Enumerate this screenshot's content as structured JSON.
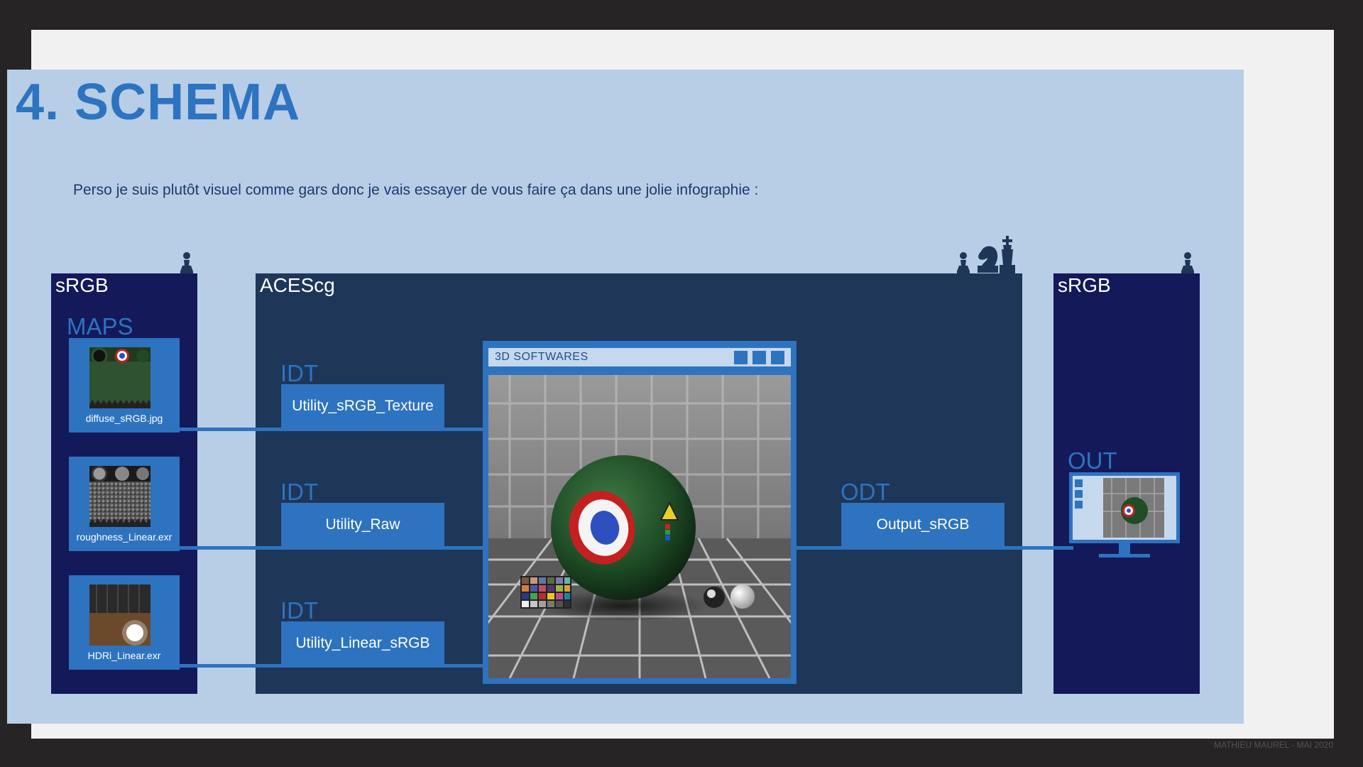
{
  "slide": {
    "title": "4. SCHEMA",
    "intro": "Perso je suis plutôt visuel comme gars donc je vais essayer de vous faire ça dans une jolie infographie :",
    "watermark": "MATHIEU MAUREL - MAI 2020"
  },
  "input_column": {
    "label": "sRGB",
    "maps_label": "MAPS",
    "maps": [
      {
        "name": "diffuse_sRGB.jpg"
      },
      {
        "name": "roughness_Linear.exr"
      },
      {
        "name": "HDRi_Linear.exr"
      }
    ]
  },
  "aces_column": {
    "label": "ACEScg",
    "idt": [
      {
        "label": "IDT",
        "transform": "Utility_sRGB_Texture"
      },
      {
        "label": "IDT",
        "transform": "Utility_Raw"
      },
      {
        "label": "IDT",
        "transform": "Utility_Linear_sRGB"
      }
    ],
    "window_title": "3D SOFTWARES",
    "odt_label": "ODT",
    "odt_transform": "Output_sRGB"
  },
  "output_column": {
    "label": "sRGB",
    "out_label": "OUT"
  },
  "colors": {
    "accent": "#2d73c0",
    "dark_column": "#14195a",
    "aces_column": "#1e3658",
    "slide_bg": "#b7cee6"
  },
  "icons": [
    "pawn-icon",
    "knight-icon",
    "king-icon",
    "monitor-icon"
  ]
}
